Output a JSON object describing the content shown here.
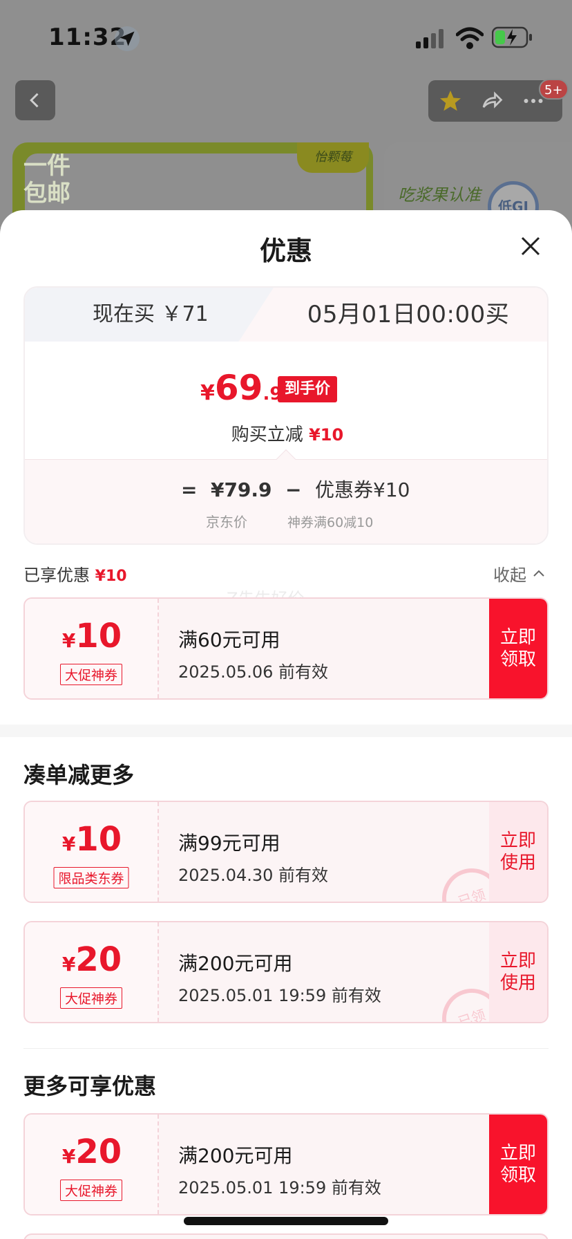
{
  "status": {
    "time": "11:32"
  },
  "header": {
    "badge": "5+"
  },
  "banner": {
    "free_shipping": "一件包邮",
    "brand": "怡颗莓",
    "slogan": "吃浆果认准",
    "low_gi": "低GI"
  },
  "sheet": {
    "title": "优惠",
    "tabs": {
      "now": "现在买 ￥71",
      "later": "05月01日00:00买"
    },
    "final_price": {
      "yen": "¥",
      "int": "69",
      "dec": ".9",
      "tag": "到手价"
    },
    "instant_cut": {
      "label": "购买立减",
      "amount": "¥10"
    },
    "calc": {
      "eq": "=",
      "jd_price": "¥79.9",
      "minus": "−",
      "coupon_label": "优惠券¥10",
      "jd_price_label": "京东价",
      "coupon_desc": "神券满60减10"
    },
    "enjoyed": {
      "label": "已享优惠",
      "amount": "¥10"
    },
    "collapse": "收起",
    "watermark": "Z先生好价"
  },
  "coupons_enjoyed": [
    {
      "yen": "¥",
      "amount": "10",
      "kind": "大促神券",
      "condition": "满60元可用",
      "expire": "2025.05.06 前有效",
      "action": "立即领取"
    }
  ],
  "section_more_orders": {
    "title": "凑单减更多",
    "coupons": [
      {
        "yen": "¥",
        "amount": "10",
        "kind": "限品类东券",
        "condition": "满99元可用",
        "expire": "2025.04.30 前有效",
        "action": "立即使用",
        "stamp": "已领"
      },
      {
        "yen": "¥",
        "amount": "20",
        "kind": "大促神券",
        "condition": "满200元可用",
        "expire": "2025.05.01 19:59 前有效",
        "action": "立即使用",
        "stamp": "已领"
      }
    ]
  },
  "section_more_offers": {
    "title": "更多可享优惠",
    "coupons": [
      {
        "yen": "¥",
        "amount": "20",
        "kind": "大促神券",
        "condition": "满200元可用",
        "expire": "2025.05.01 19:59 前有效",
        "action": "立即领取"
      }
    ]
  },
  "colors": {
    "accent": "#e8172b",
    "action_red": "#f8132c",
    "coupon_bg": "#fcf4f5",
    "coupon_border": "#f4d3d9"
  },
  "icons": [
    "location-arrow-icon",
    "signal-icon",
    "wifi-icon",
    "battery-charging-icon",
    "back-chevron-icon",
    "star-icon",
    "share-icon",
    "more-dots-icon",
    "close-icon",
    "chevron-up-icon"
  ]
}
